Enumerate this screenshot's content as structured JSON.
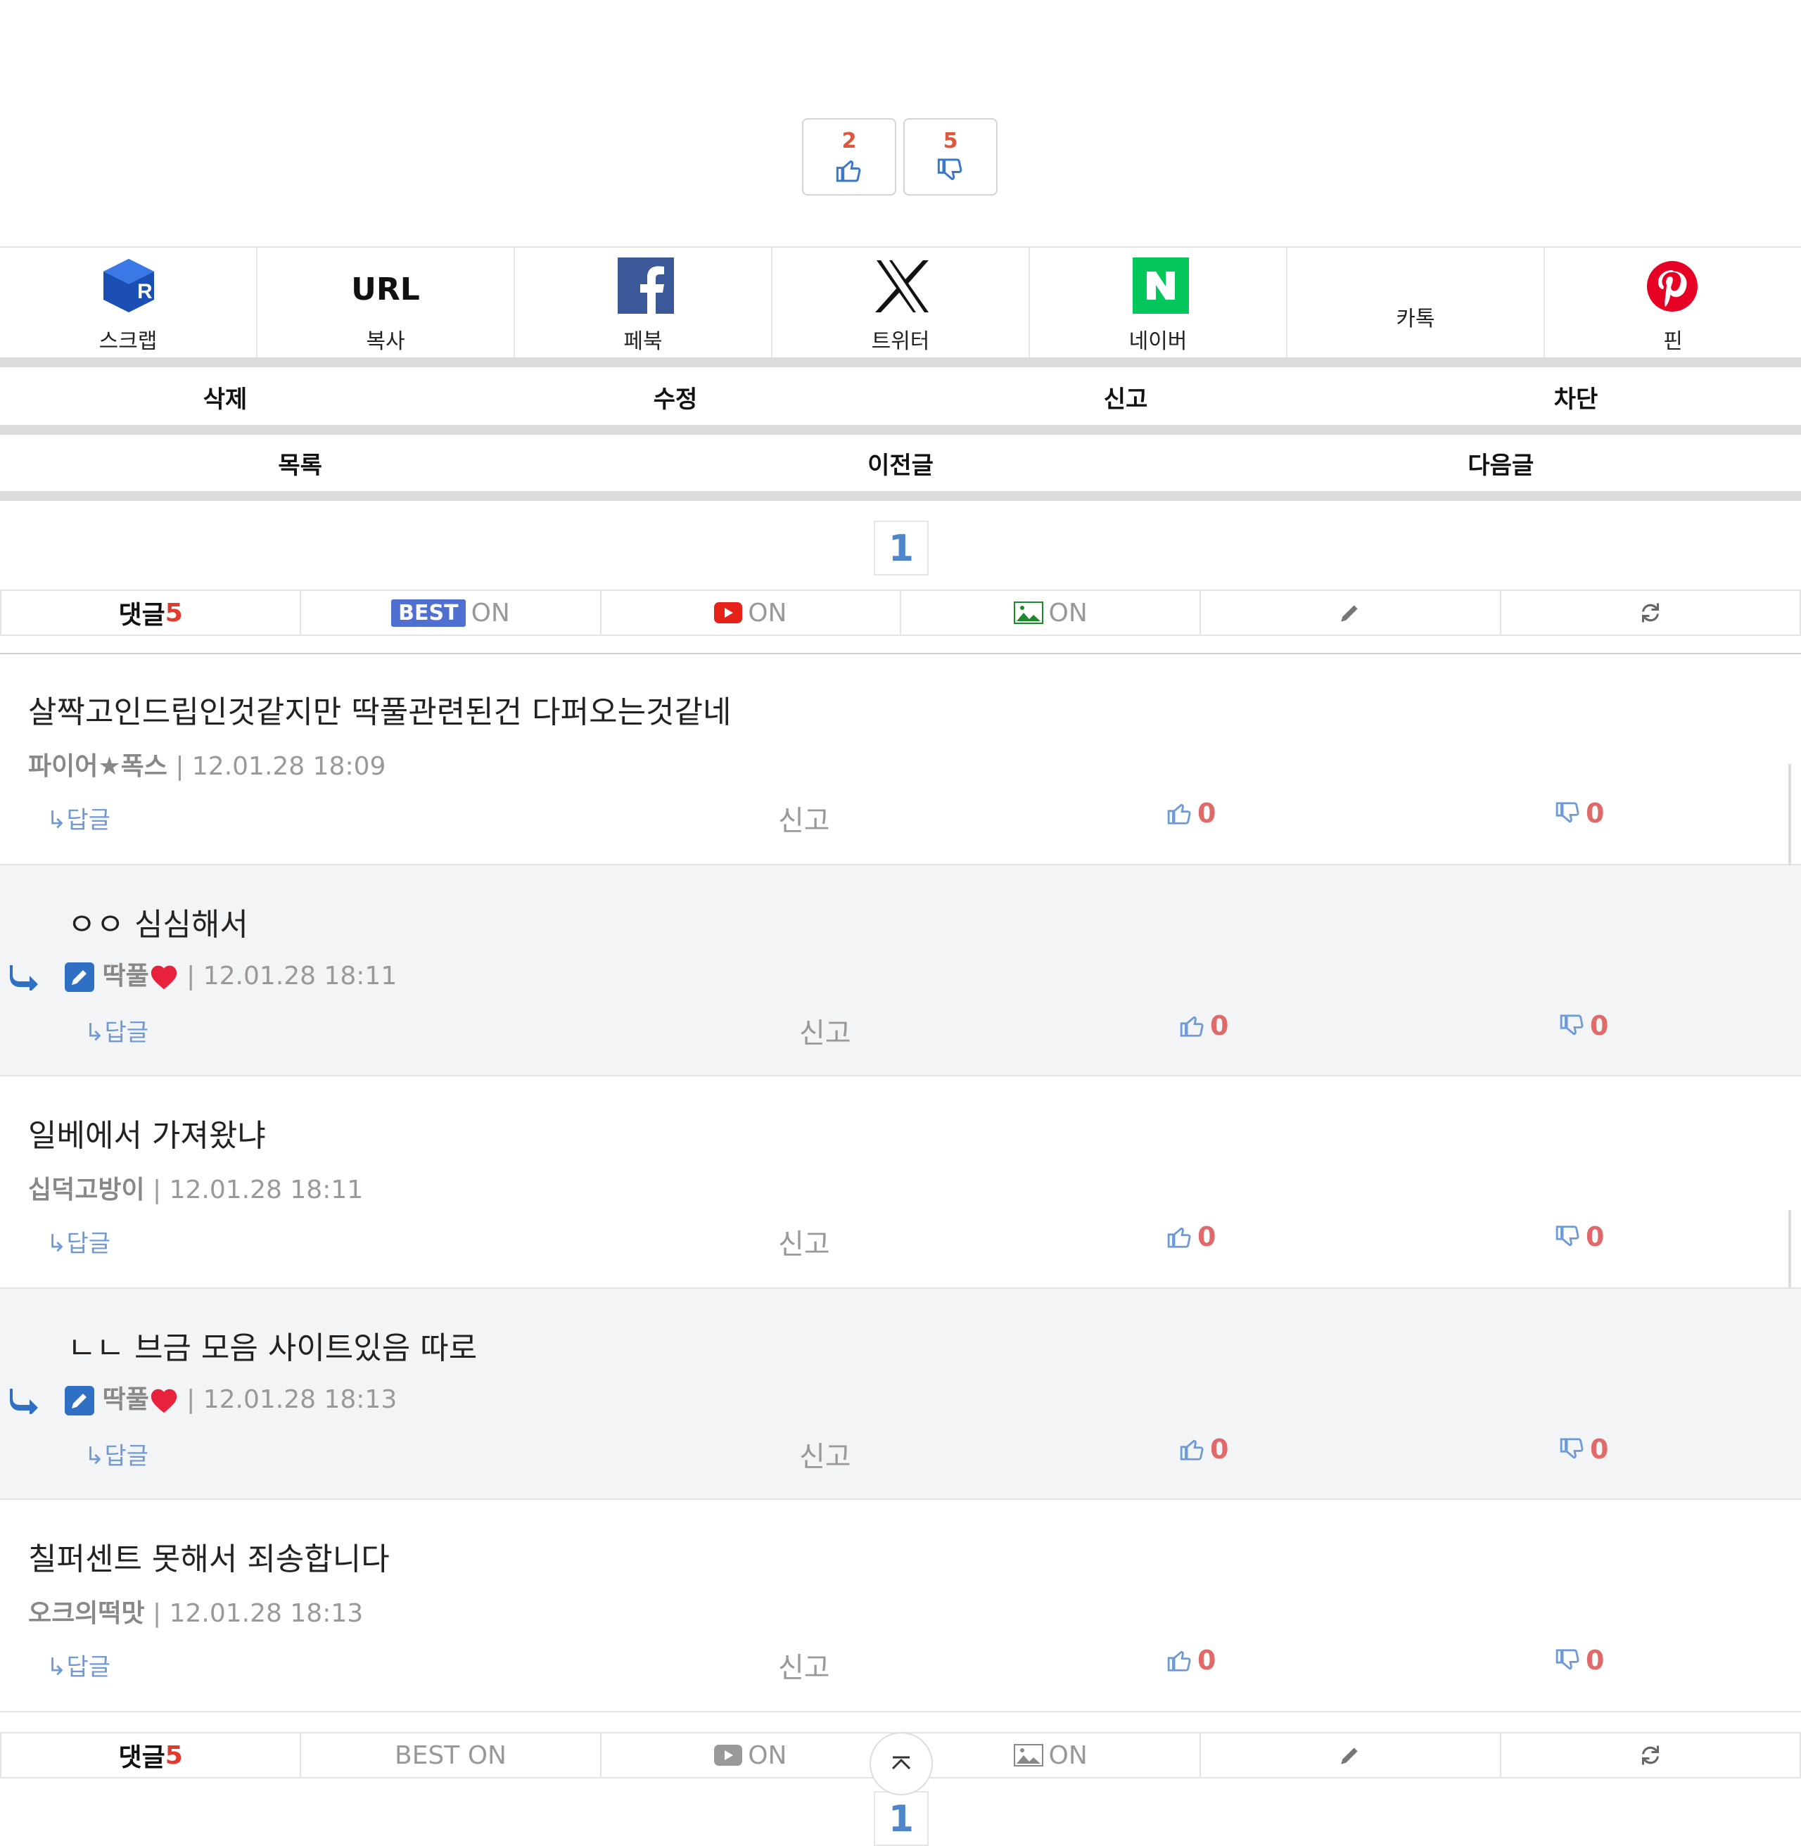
{
  "votes": {
    "up": "2",
    "down": "5"
  },
  "share": {
    "scrap": "스크랩",
    "url_title": "URL",
    "url": "복사",
    "facebook": "페북",
    "twitter": "트위터",
    "naver": "네이버",
    "kakao": "카톡",
    "pin": "핀"
  },
  "actions": {
    "delete": "삭제",
    "edit": "수정",
    "report": "신고",
    "block": "차단"
  },
  "nav": {
    "list": "목록",
    "prev": "이전글",
    "next": "다음글"
  },
  "page": "1",
  "toolbar": {
    "comments_label": "댓글",
    "comments_count": "5",
    "best_badge": "BEST",
    "best_text": "BEST ON",
    "on": "ON"
  },
  "comments": [
    {
      "text": "살짝고인드립인것같지만 딱풀관련된건 다퍼오는것같네",
      "nick": "파이어★폭스",
      "date": "12.01.28 18:09",
      "reply": "↳답글",
      "report": "신고",
      "up": "0",
      "down": "0"
    },
    {
      "text": "ㅇㅇ 심심해서",
      "nick": "딱풀",
      "date": "12.01.28 18:11",
      "reply": "↳답글",
      "report": "신고",
      "up": "0",
      "down": "0"
    },
    {
      "text": "일베에서 가져왔냐",
      "nick": "십덕고방이",
      "date": "12.01.28 18:11",
      "reply": "↳답글",
      "report": "신고",
      "up": "0",
      "down": "0"
    },
    {
      "text": "ㄴㄴ 브금 모음 사이트있음 따로",
      "nick": "딱풀",
      "date": "12.01.28 18:13",
      "reply": "↳답글",
      "report": "신고",
      "up": "0",
      "down": "0"
    },
    {
      "text": "칠퍼센트 못해서 죄송합니다",
      "nick": "오크의떡맛",
      "date": "12.01.28 18:13",
      "reply": "↳답글",
      "report": "신고",
      "up": "0",
      "down": "0"
    }
  ],
  "colors": {
    "accent": "#4e86c9",
    "count_red": "#e23b2e",
    "vote_red": "#e06a6a",
    "best_bg": "#4f6fd1"
  }
}
